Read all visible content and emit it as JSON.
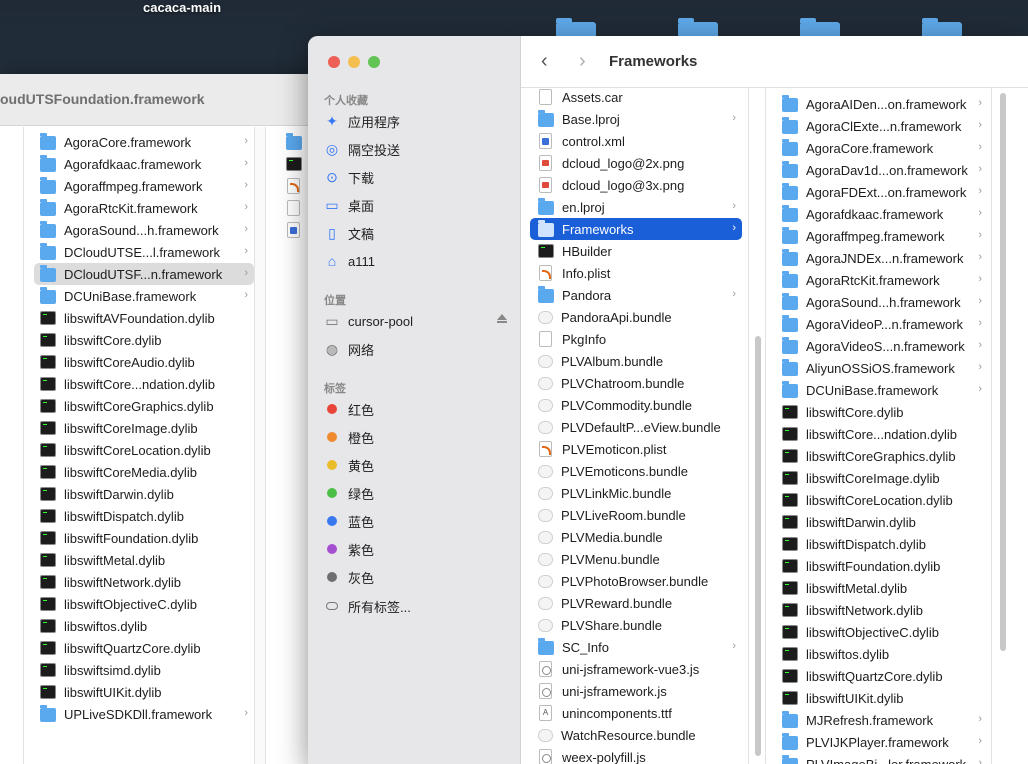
{
  "desktop": {
    "title": "cacaca-main"
  },
  "back_window": {
    "title": "oudUTSFoundation.framework",
    "items": [
      {
        "label": "AgoraCore.framework",
        "icon": "folder",
        "chevron": true
      },
      {
        "label": "Agorafdkaac.framework",
        "icon": "folder",
        "chevron": true
      },
      {
        "label": "Agoraffmpeg.framework",
        "icon": "folder",
        "chevron": true
      },
      {
        "label": "AgoraRtcKit.framework",
        "icon": "folder",
        "chevron": true
      },
      {
        "label": "AgoraSound...h.framework",
        "icon": "folder",
        "chevron": true
      },
      {
        "label": "DCloudUTSE...l.framework",
        "icon": "folder",
        "chevron": true
      },
      {
        "label": "DCloudUTSF...n.framework",
        "icon": "folder",
        "chevron": true,
        "selected": true
      },
      {
        "label": "DCUniBase.framework",
        "icon": "folder",
        "chevron": true
      },
      {
        "label": "libswiftAVFoundation.dylib",
        "icon": "exec"
      },
      {
        "label": "libswiftCore.dylib",
        "icon": "exec"
      },
      {
        "label": "libswiftCoreAudio.dylib",
        "icon": "exec"
      },
      {
        "label": "libswiftCore...ndation.dylib",
        "icon": "exec"
      },
      {
        "label": "libswiftCoreGraphics.dylib",
        "icon": "exec"
      },
      {
        "label": "libswiftCoreImage.dylib",
        "icon": "exec"
      },
      {
        "label": "libswiftCoreLocation.dylib",
        "icon": "exec"
      },
      {
        "label": "libswiftCoreMedia.dylib",
        "icon": "exec"
      },
      {
        "label": "libswiftDarwin.dylib",
        "icon": "exec"
      },
      {
        "label": "libswiftDispatch.dylib",
        "icon": "exec"
      },
      {
        "label": "libswiftFoundation.dylib",
        "icon": "exec"
      },
      {
        "label": "libswiftMetal.dylib",
        "icon": "exec"
      },
      {
        "label": "libswiftNetwork.dylib",
        "icon": "exec"
      },
      {
        "label": "libswiftObjectiveC.dylib",
        "icon": "exec"
      },
      {
        "label": "libswiftos.dylib",
        "icon": "exec"
      },
      {
        "label": "libswiftQuartzCore.dylib",
        "icon": "exec"
      },
      {
        "label": "libswiftsimd.dylib",
        "icon": "exec"
      },
      {
        "label": "libswiftUIKit.dylib",
        "icon": "exec"
      },
      {
        "label": "UPLiveSDKDll.framework",
        "icon": "folder",
        "chevron": true
      }
    ],
    "col2_icons": [
      "folder",
      "exec",
      "rss",
      "doc",
      "xml"
    ]
  },
  "sidebar": {
    "favorites_header": "个人收藏",
    "favorites": [
      {
        "label": "应用程序",
        "icon": "apps-icon",
        "glyph": "✦"
      },
      {
        "label": "隔空投送",
        "icon": "airdrop-icon",
        "glyph": "◎"
      },
      {
        "label": "下载",
        "icon": "download-icon",
        "glyph": "⊙"
      },
      {
        "label": "桌面",
        "icon": "desktop-icon",
        "glyph": "▭"
      },
      {
        "label": "文稿",
        "icon": "document-icon",
        "glyph": "▯"
      },
      {
        "label": "a111",
        "icon": "home-icon",
        "glyph": "⌂"
      }
    ],
    "locations_header": "位置",
    "locations": [
      {
        "label": "cursor-pool",
        "icon": "disk-icon",
        "glyph": "▭"
      },
      {
        "label": "网络",
        "icon": "network-icon",
        "glyph": "◍"
      }
    ],
    "tags_header": "标签",
    "tags": [
      {
        "label": "红色",
        "color": "#e8443a"
      },
      {
        "label": "橙色",
        "color": "#ef8a2e"
      },
      {
        "label": "黄色",
        "color": "#e9bd2a"
      },
      {
        "label": "绿色",
        "color": "#4bbf45"
      },
      {
        "label": "蓝色",
        "color": "#3a78f0"
      },
      {
        "label": "紫色",
        "color": "#a34fd0"
      },
      {
        "label": "灰色",
        "color": "#6e6e72"
      }
    ],
    "all_tags": "所有标签..."
  },
  "toolbar": {
    "title": "Frameworks",
    "back": "‹",
    "forward": "›"
  },
  "column1": [
    {
      "label": "Assets.car",
      "icon": "doc"
    },
    {
      "label": "Base.lproj",
      "icon": "folder",
      "chevron": true
    },
    {
      "label": "control.xml",
      "icon": "xml"
    },
    {
      "label": "dcloud_logo@2x.png",
      "icon": "png"
    },
    {
      "label": "dcloud_logo@3x.png",
      "icon": "png"
    },
    {
      "label": "en.lproj",
      "icon": "folder",
      "chevron": true
    },
    {
      "label": "Frameworks",
      "icon": "folder",
      "chevron": true,
      "selected": true
    },
    {
      "label": "HBuilder",
      "icon": "exec"
    },
    {
      "label": "Info.plist",
      "icon": "rss"
    },
    {
      "label": "Pandora",
      "icon": "folder",
      "chevron": true
    },
    {
      "label": "PandoraApi.bundle",
      "icon": "bundle"
    },
    {
      "label": "PkgInfo",
      "icon": "doc"
    },
    {
      "label": "PLVAlbum.bundle",
      "icon": "bundle"
    },
    {
      "label": "PLVChatroom.bundle",
      "icon": "bundle"
    },
    {
      "label": "PLVCommodity.bundle",
      "icon": "bundle"
    },
    {
      "label": "PLVDefaultP...eView.bundle",
      "icon": "bundle"
    },
    {
      "label": "PLVEmoticon.plist",
      "icon": "rss"
    },
    {
      "label": "PLVEmoticons.bundle",
      "icon": "bundle"
    },
    {
      "label": "PLVLinkMic.bundle",
      "icon": "bundle"
    },
    {
      "label": "PLVLiveRoom.bundle",
      "icon": "bundle"
    },
    {
      "label": "PLVMedia.bundle",
      "icon": "bundle"
    },
    {
      "label": "PLVMenu.bundle",
      "icon": "bundle"
    },
    {
      "label": "PLVPhotoBrowser.bundle",
      "icon": "bundle"
    },
    {
      "label": "PLVReward.bundle",
      "icon": "bundle"
    },
    {
      "label": "PLVShare.bundle",
      "icon": "bundle"
    },
    {
      "label": "SC_Info",
      "icon": "folder",
      "chevron": true
    },
    {
      "label": "uni-jsframework-vue3.js",
      "icon": "js"
    },
    {
      "label": "uni-jsframework.js",
      "icon": "js"
    },
    {
      "label": "unincomponents.ttf",
      "icon": "font"
    },
    {
      "label": "WatchResource.bundle",
      "icon": "bundle"
    },
    {
      "label": "weex-polyfill.js",
      "icon": "js"
    }
  ],
  "column2": [
    {
      "label": "AgoraAIDen...on.framework",
      "icon": "folder",
      "chevron": true
    },
    {
      "label": "AgoraClExte...n.framework",
      "icon": "folder",
      "chevron": true
    },
    {
      "label": "AgoraCore.framework",
      "icon": "folder",
      "chevron": true
    },
    {
      "label": "AgoraDav1d...on.framework",
      "icon": "folder",
      "chevron": true
    },
    {
      "label": "AgoraFDExt...on.framework",
      "icon": "folder",
      "chevron": true
    },
    {
      "label": "Agorafdkaac.framework",
      "icon": "folder",
      "chevron": true
    },
    {
      "label": "Agoraffmpeg.framework",
      "icon": "folder",
      "chevron": true
    },
    {
      "label": "AgoraJNDEx...n.framework",
      "icon": "folder",
      "chevron": true
    },
    {
      "label": "AgoraRtcKit.framework",
      "icon": "folder",
      "chevron": true
    },
    {
      "label": "AgoraSound...h.framework",
      "icon": "folder",
      "chevron": true
    },
    {
      "label": "AgoraVideoP...n.framework",
      "icon": "folder",
      "chevron": true
    },
    {
      "label": "AgoraVideoS...n.framework",
      "icon": "folder",
      "chevron": true
    },
    {
      "label": "AliyunOSSiOS.framework",
      "icon": "folder",
      "chevron": true
    },
    {
      "label": "DCUniBase.framework",
      "icon": "folder",
      "chevron": true
    },
    {
      "label": "libswiftCore.dylib",
      "icon": "exec"
    },
    {
      "label": "libswiftCore...ndation.dylib",
      "icon": "exec"
    },
    {
      "label": "libswiftCoreGraphics.dylib",
      "icon": "exec"
    },
    {
      "label": "libswiftCoreImage.dylib",
      "icon": "exec"
    },
    {
      "label": "libswiftCoreLocation.dylib",
      "icon": "exec"
    },
    {
      "label": "libswiftDarwin.dylib",
      "icon": "exec"
    },
    {
      "label": "libswiftDispatch.dylib",
      "icon": "exec"
    },
    {
      "label": "libswiftFoundation.dylib",
      "icon": "exec"
    },
    {
      "label": "libswiftMetal.dylib",
      "icon": "exec"
    },
    {
      "label": "libswiftNetwork.dylib",
      "icon": "exec"
    },
    {
      "label": "libswiftObjectiveC.dylib",
      "icon": "exec"
    },
    {
      "label": "libswiftos.dylib",
      "icon": "exec"
    },
    {
      "label": "libswiftQuartzCore.dylib",
      "icon": "exec"
    },
    {
      "label": "libswiftUIKit.dylib",
      "icon": "exec"
    },
    {
      "label": "MJRefresh.framework",
      "icon": "folder",
      "chevron": true
    },
    {
      "label": "PLVIJKPlayer.framework",
      "icon": "folder",
      "chevron": true
    },
    {
      "label": "PLVImageBi...ler.framework",
      "icon": "folder",
      "chevron": true
    }
  ],
  "colors": {
    "selection": "#1a5fd8",
    "folder": "#5aa9ef",
    "close": "#ee5f57",
    "minimize": "#f5bf4f",
    "zoom": "#61c454"
  }
}
